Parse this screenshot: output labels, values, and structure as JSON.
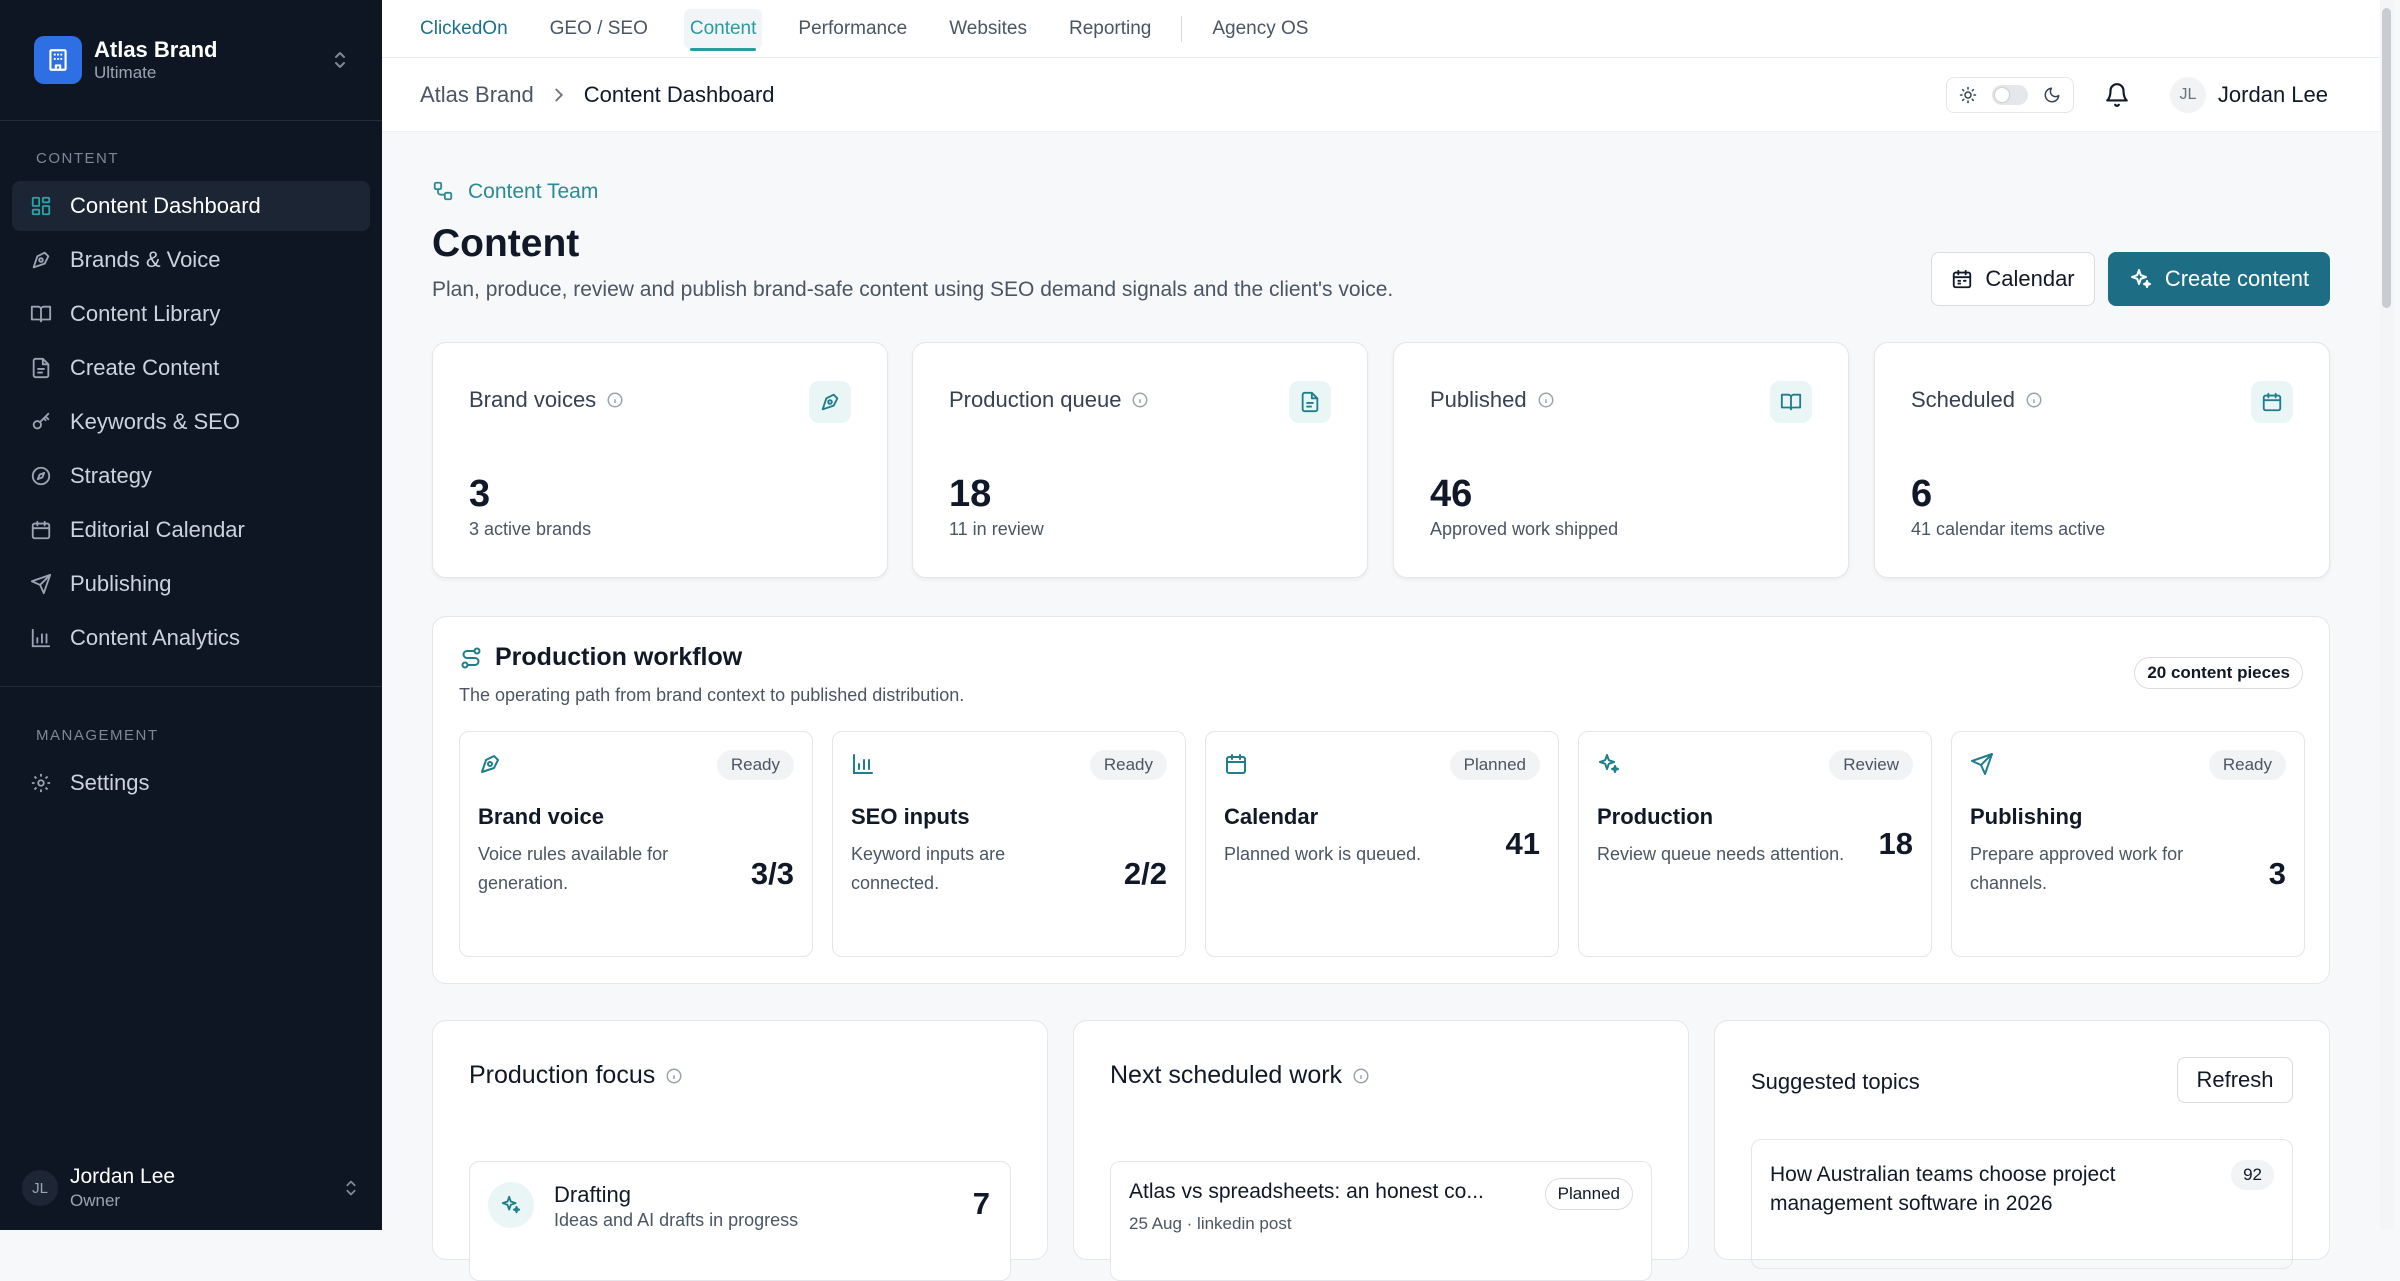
{
  "sidebar": {
    "org_name": "Atlas Brand",
    "org_plan": "Ultimate",
    "section_content": "Content",
    "items": [
      {
        "label": "Content Dashboard",
        "icon": "dashboard-icon",
        "active": true
      },
      {
        "label": "Brands & Voice",
        "icon": "pen-nib-icon"
      },
      {
        "label": "Content Library",
        "icon": "book-icon"
      },
      {
        "label": "Create Content",
        "icon": "document-icon"
      },
      {
        "label": "Keywords & SEO",
        "icon": "key-icon"
      },
      {
        "label": "Strategy",
        "icon": "compass-icon"
      },
      {
        "label": "Editorial Calendar",
        "icon": "calendar-icon"
      },
      {
        "label": "Publishing",
        "icon": "send-icon"
      },
      {
        "label": "Content Analytics",
        "icon": "bar-chart-icon"
      }
    ],
    "section_management": "Management",
    "management_items": [
      {
        "label": "Settings",
        "icon": "gear-icon"
      }
    ],
    "user": {
      "initials": "JL",
      "name": "Jordan Lee",
      "role": "Owner"
    }
  },
  "topnav": {
    "brand": "ClickedOn",
    "items": [
      "GEO / SEO",
      "Content",
      "Performance",
      "Websites",
      "Reporting"
    ],
    "active": "Content",
    "agency": "Agency OS"
  },
  "header": {
    "breadcrumb": [
      "Atlas Brand",
      "Content Dashboard"
    ],
    "user_initials": "JL",
    "user_name": "Jordan Lee"
  },
  "page": {
    "team": "Content Team",
    "title": "Content",
    "subtitle": "Plan, produce, review and publish brand-safe content using SEO demand signals and the client's voice.",
    "calendar_button": "Calendar",
    "create_button": "Create content"
  },
  "stats": [
    {
      "label": "Brand voices",
      "value": "3",
      "sub": "3 active brands",
      "icon": "pen-nib-icon"
    },
    {
      "label": "Production queue",
      "value": "18",
      "sub": "11 in review",
      "icon": "document-icon"
    },
    {
      "label": "Published",
      "value": "46",
      "sub": "Approved work shipped",
      "icon": "book-icon"
    },
    {
      "label": "Scheduled",
      "value": "6",
      "sub": "41 calendar items active",
      "icon": "calendar-icon"
    }
  ],
  "workflow": {
    "title": "Production workflow",
    "subtitle": "The operating path from brand context to published distribution.",
    "count": "20 content pieces",
    "steps": [
      {
        "name": "Brand voice",
        "status": "Ready",
        "desc": "Voice rules available for generation.",
        "value": "3/3",
        "icon": "pen-nib-icon"
      },
      {
        "name": "SEO inputs",
        "status": "Ready",
        "desc": "Keyword inputs are connected.",
        "value": "2/2",
        "icon": "bar-chart-icon"
      },
      {
        "name": "Calendar",
        "status": "Planned",
        "desc": "Planned work is queued.",
        "value": "41",
        "icon": "calendar-icon"
      },
      {
        "name": "Production",
        "status": "Review",
        "desc": "Review queue needs attention.",
        "value": "18",
        "icon": "sparkles-icon"
      },
      {
        "name": "Publishing",
        "status": "Ready",
        "desc": "Prepare approved work for channels.",
        "value": "3",
        "icon": "send-icon"
      }
    ]
  },
  "production_focus": {
    "title": "Production focus",
    "item": {
      "name": "Drafting",
      "sub": "Ideas and AI drafts in progress",
      "value": "7"
    }
  },
  "next_work": {
    "title": "Next scheduled work",
    "item": {
      "title": "Atlas vs spreadsheets: an honest co...",
      "badge": "Planned",
      "meta": "25 Aug · linkedin post"
    }
  },
  "suggested_topics": {
    "title": "Suggested topics",
    "refresh": "Refresh",
    "item": {
      "text": "How Australian teams choose project management software in 2026",
      "score": "92"
    }
  },
  "colors": {
    "accent": "#1d6e84",
    "teal": "#2b9aa1",
    "sidebar_bg": "#0f1623",
    "org_logo": "#2f6fe4"
  }
}
